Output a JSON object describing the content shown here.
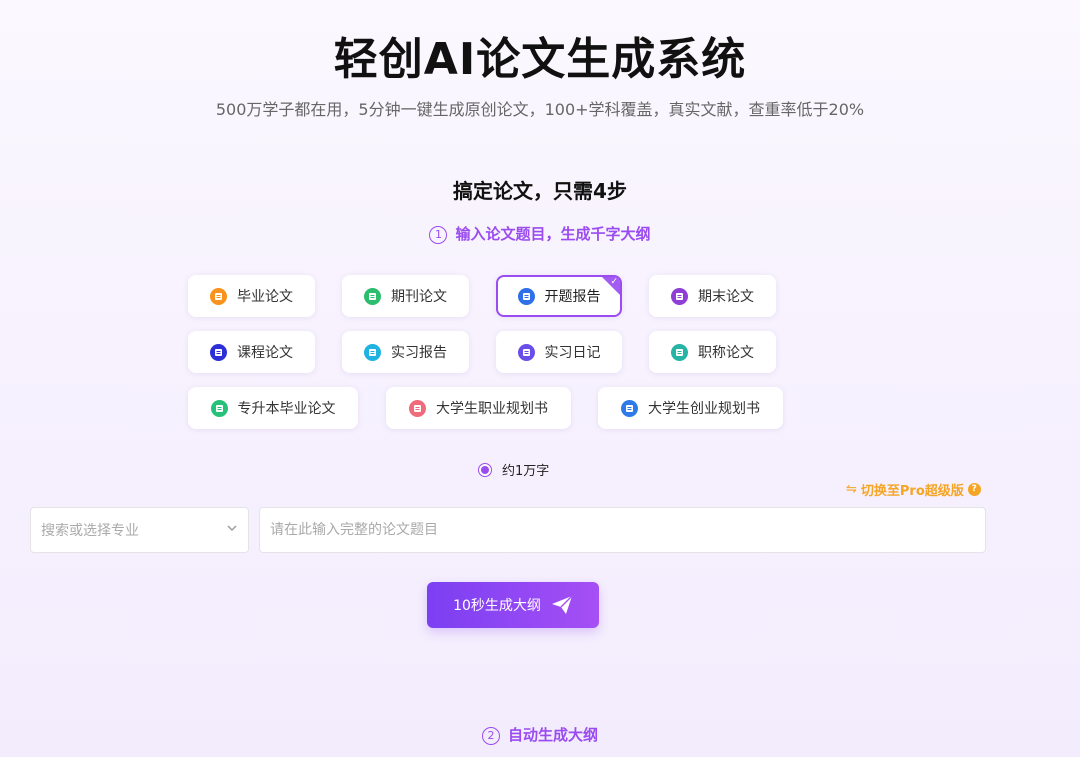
{
  "header": {
    "title": "轻创AI论文生成系统",
    "subtitle": "500万学子都在用，5分钟一键生成原创论文，100+学科覆盖，真实文献，查重率低于20%"
  },
  "section": {
    "title": "搞定论文，只需4步"
  },
  "steps": [
    {
      "num": "1",
      "label": "输入论文题目，生成千字大纲"
    },
    {
      "num": "2",
      "label": "自动生成大纲"
    }
  ],
  "paper_types": [
    {
      "label": "毕业论文",
      "color": "#f7931e",
      "icon": "book-icon",
      "selected": false
    },
    {
      "label": "期刊论文",
      "color": "#2dbd6e",
      "icon": "journal-icon",
      "selected": false
    },
    {
      "label": "开题报告",
      "color": "#2f6fe8",
      "icon": "report-icon",
      "selected": true
    },
    {
      "label": "期末论文",
      "color": "#8f3fd6",
      "icon": "exam-icon",
      "selected": false
    },
    {
      "label": "课程论文",
      "color": "#2c2fd6",
      "icon": "course-icon",
      "selected": false
    },
    {
      "label": "实习报告",
      "color": "#20b2e0",
      "icon": "internship-icon",
      "selected": false
    },
    {
      "label": "实习日记",
      "color": "#6a4ee8",
      "icon": "diary-icon",
      "selected": false
    },
    {
      "label": "职称论文",
      "color": "#27b3a6",
      "icon": "title-paper-icon",
      "selected": false
    },
    {
      "label": "专升本毕业论文",
      "color": "#27c27a",
      "icon": "upgrade-icon",
      "selected": false
    },
    {
      "label": "大学生职业规划书",
      "color": "#f06a7a",
      "icon": "career-icon",
      "selected": false
    },
    {
      "label": "大学生创业规划书",
      "color": "#2f7ae8",
      "icon": "startup-icon",
      "selected": false
    }
  ],
  "word_count": {
    "label": "约1万字",
    "selected": true
  },
  "pro_switch": {
    "label": "切换至Pro超级版",
    "arrows": "⇋",
    "help": "?"
  },
  "major_select": {
    "placeholder": "搜索或选择专业",
    "chevron": "⌄"
  },
  "title_input": {
    "placeholder": "请在此输入完整的论文题目",
    "value": ""
  },
  "generate_button": {
    "label": "10秒生成大纲"
  },
  "colors": {
    "accent": "#9a4cf0",
    "pro": "#f5a524"
  }
}
